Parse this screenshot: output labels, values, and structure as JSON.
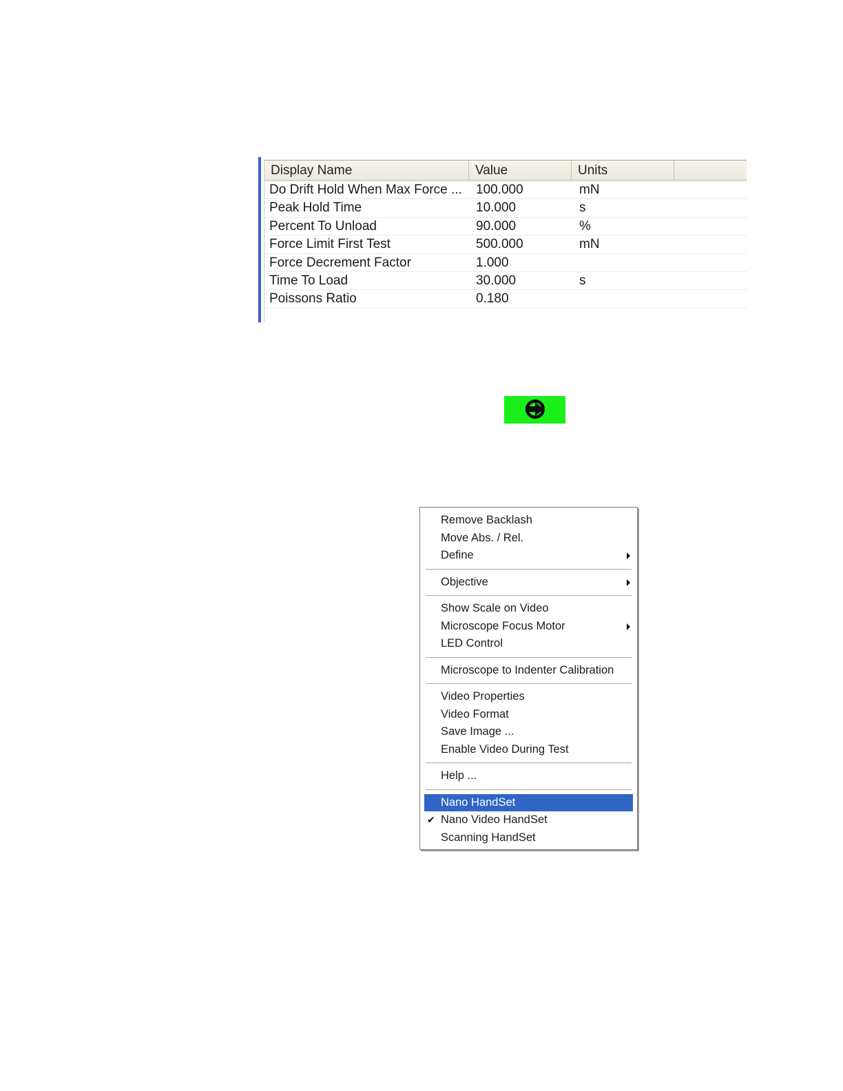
{
  "params_table": {
    "headers": [
      "Display Name",
      "Value",
      "Units",
      ""
    ],
    "rows": [
      {
        "name": "Do Drift Hold When Max Force ...",
        "value": "100.000",
        "units": "mN"
      },
      {
        "name": "Peak Hold Time",
        "value": "10.000",
        "units": "s"
      },
      {
        "name": "Percent To Unload",
        "value": "90.000",
        "units": "%"
      },
      {
        "name": "Force Limit First Test",
        "value": "500.000",
        "units": "mN"
      },
      {
        "name": "Force Decrement Factor",
        "value": "1.000",
        "units": ""
      },
      {
        "name": "Time To Load",
        "value": "30.000",
        "units": "s"
      },
      {
        "name": "Poissons Ratio",
        "value": "0.180",
        "units": ""
      }
    ]
  },
  "go_button": {
    "icon": "arrow-right-circle-icon",
    "color": "#19ef19"
  },
  "context_menu": {
    "groups": [
      [
        {
          "label": "Remove Backlash"
        },
        {
          "label": "Move Abs. / Rel."
        },
        {
          "label": "Define",
          "submenu": true
        }
      ],
      [
        {
          "label": "Objective",
          "submenu": true
        }
      ],
      [
        {
          "label": "Show Scale on Video"
        },
        {
          "label": "Microscope Focus Motor",
          "submenu": true
        },
        {
          "label": "LED Control"
        }
      ],
      [
        {
          "label": "Microscope to Indenter Calibration"
        }
      ],
      [
        {
          "label": "Video Properties"
        },
        {
          "label": "Video Format"
        },
        {
          "label": "Save Image ..."
        },
        {
          "label": "Enable Video During Test"
        }
      ],
      [
        {
          "label": "Help ..."
        }
      ],
      [
        {
          "label": "Nano HandSet",
          "selected": true
        },
        {
          "label": "Nano Video HandSet",
          "checked": true
        },
        {
          "label": "Scanning HandSet"
        }
      ]
    ],
    "highlight_color": "#3165c5"
  }
}
